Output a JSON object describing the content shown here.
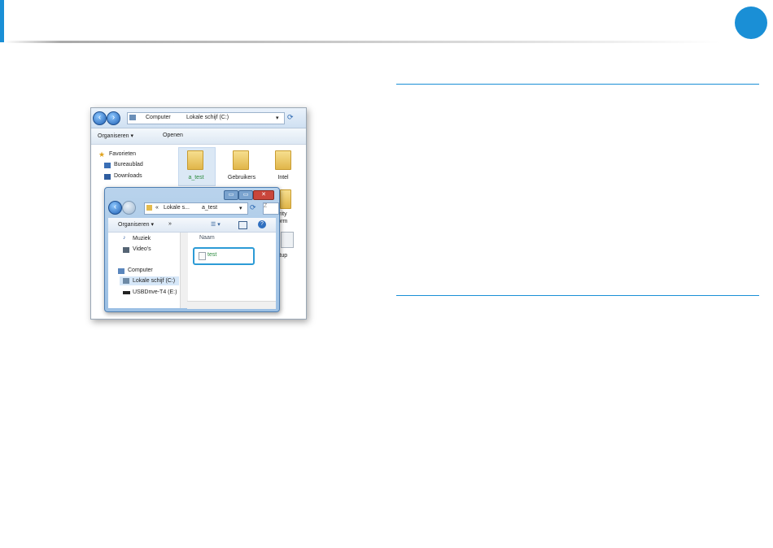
{
  "explorer": {
    "nav_back": "‹",
    "nav_forward": "›",
    "breadcrumb": [
      "Computer",
      "Lokale schijf (C:)"
    ],
    "toolbar": {
      "organize": "Organiseren ▾",
      "open": "Openen"
    },
    "favorites": [
      "Favorieten",
      "Bureaublad",
      "Downloads"
    ],
    "folders": [
      "a_test",
      "Gebruikers",
      "Intel"
    ],
    "partial_labels": [
      "ecurity",
      "latform",
      "setup"
    ]
  },
  "dialog": {
    "buttons": [
      "▭",
      "▭",
      "✕"
    ],
    "breadcrumb": [
      "«",
      "Lokale s...",
      "a_test"
    ],
    "search_placeholder": "Z",
    "toolbar": {
      "organize": "Organiseren ▾",
      "more": "»",
      "help": "?"
    },
    "nav_items": [
      "Muziek",
      "Video's",
      "Computer",
      "Lokale schijf (C:)",
      "USBDrive-T4 (E:)"
    ],
    "column_header": "Naam",
    "file": "test"
  },
  "colors": {
    "accent": "#1a8fd6",
    "highlight": "#2c9bd6"
  }
}
